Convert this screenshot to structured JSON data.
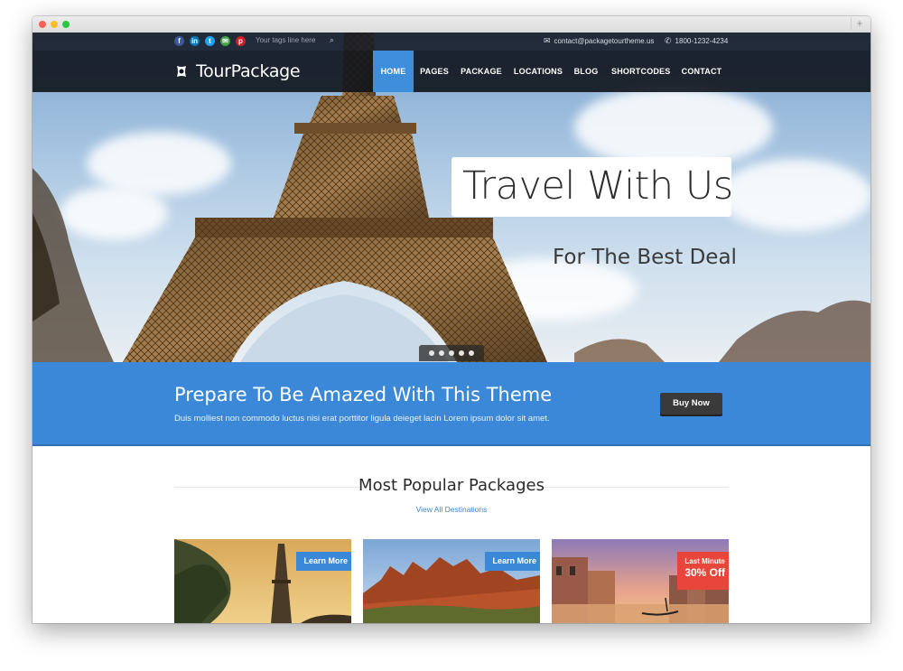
{
  "topbar": {
    "social_icons": [
      "facebook-icon",
      "linkedin-icon",
      "twitter-icon",
      "email-icon",
      "pinterest-icon"
    ],
    "tagline": "Your tags line here",
    "email": "contact@packagetourtheme.us",
    "phone": "1800-1232-4234"
  },
  "brand": {
    "logo_text": "TourPackage"
  },
  "nav": {
    "items": [
      "HOME",
      "PAGES",
      "PACKAGE",
      "LOCATIONS",
      "BLOG",
      "SHORTCODES",
      "CONTACT"
    ],
    "active": "HOME"
  },
  "hero": {
    "title": "Travel With Us",
    "subtitle": "For The Best Deal",
    "slides": 5
  },
  "cta": {
    "title": "Prepare To Be Amazed With This Theme",
    "text": "Duis molliest non commodo luctus nisi erat porttitor ligula deieget lacin Lorem ipsum dolor sit amet.",
    "button": "Buy Now"
  },
  "packages": {
    "title": "Most Popular Packages",
    "view_all": "View All Destinations",
    "cards": [
      {
        "tag": "Learn More"
      },
      {
        "tag": "Learn More"
      },
      {
        "tag_line1": "Last Minute",
        "tag_line2": "30% Off"
      }
    ]
  },
  "colors": {
    "accent": "#3b88d8",
    "nav_bg": "#10141c",
    "sale": "#e8463a",
    "button_dark": "#3a3a3a"
  }
}
